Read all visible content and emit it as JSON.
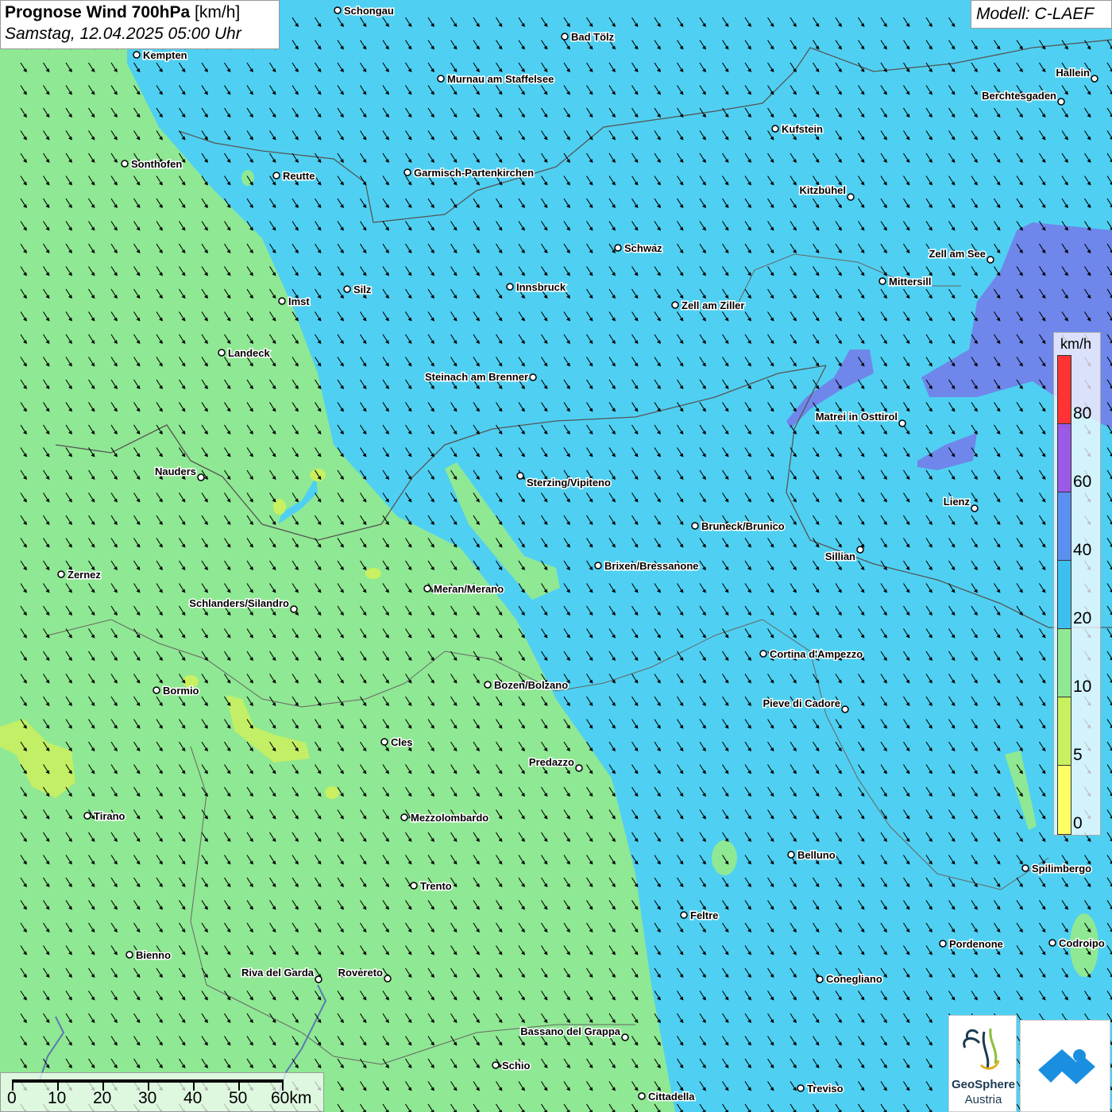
{
  "title": {
    "main": "Prognose Wind 700hPa",
    "unit": "[km/h]",
    "datetime": "Samstag, 12.04.2025 05:00 Uhr"
  },
  "model": "Modell: C-LAEF",
  "legend": {
    "unit": "km/h",
    "ticks": [
      "80",
      "60",
      "40",
      "20",
      "10",
      "5",
      "0"
    ],
    "colors": [
      "#ff3333",
      "#9b59e6",
      "#5b8ff0",
      "#3fbfef",
      "#8fe893",
      "#c8f060",
      "#ffff66"
    ]
  },
  "scalebar": {
    "labels": [
      "0",
      "10",
      "20",
      "30",
      "40",
      "50",
      "60km"
    ]
  },
  "logos": {
    "geosphere_line1": "GeoSphere",
    "geosphere_line2": "Austria"
  },
  "colors": {
    "calm_green": "#8fe893",
    "moderate_blue": "#4fd0f2",
    "strong_purple": "#6f86ea"
  },
  "cities": [
    {
      "name": "Schongau"
    },
    {
      "name": "Bad Tölz"
    },
    {
      "name": "Kempten"
    },
    {
      "name": "Murnau am Staffelsee"
    },
    {
      "name": "Hallein"
    },
    {
      "name": "Berchtesgaden"
    },
    {
      "name": "Kufstein"
    },
    {
      "name": "Sonthofen"
    },
    {
      "name": "Reutte"
    },
    {
      "name": "Garmisch-Partenkirchen"
    },
    {
      "name": "Kitzbühel"
    },
    {
      "name": "Schwaz"
    },
    {
      "name": "Zell am See"
    },
    {
      "name": "Mittersill"
    },
    {
      "name": "Innsbruck"
    },
    {
      "name": "Silz"
    },
    {
      "name": "Imst"
    },
    {
      "name": "Zell am Ziller"
    },
    {
      "name": "Landeck"
    },
    {
      "name": "Steinach am Brenner"
    },
    {
      "name": "Matrei in Osttirol"
    },
    {
      "name": "Nauders"
    },
    {
      "name": "Sterzing/Vipiteno"
    },
    {
      "name": "Lienz"
    },
    {
      "name": "Bruneck/Brunico"
    },
    {
      "name": "Sillian"
    },
    {
      "name": "Brixen/Bressanone"
    },
    {
      "name": "Zernez"
    },
    {
      "name": "Meran/Merano"
    },
    {
      "name": "Schlanders/Silandro"
    },
    {
      "name": "Cortina d'Ampezzo"
    },
    {
      "name": "Bozen/Bolzano"
    },
    {
      "name": "Bormio"
    },
    {
      "name": "Pieve di Cadore"
    },
    {
      "name": "Cles"
    },
    {
      "name": "Predazzo"
    },
    {
      "name": "Tirano"
    },
    {
      "name": "Mezzolombardo"
    },
    {
      "name": "Belluno"
    },
    {
      "name": "Spilimbergo"
    },
    {
      "name": "Trento"
    },
    {
      "name": "Feltre"
    },
    {
      "name": "Pordenone"
    },
    {
      "name": "Codroipo"
    },
    {
      "name": "Bienno"
    },
    {
      "name": "Riva del Garda"
    },
    {
      "name": "Rovereto"
    },
    {
      "name": "Conegliano"
    },
    {
      "name": "Bassano del Grappa"
    },
    {
      "name": "Schio"
    },
    {
      "name": "Treviso"
    },
    {
      "name": "Cittadella"
    }
  ]
}
